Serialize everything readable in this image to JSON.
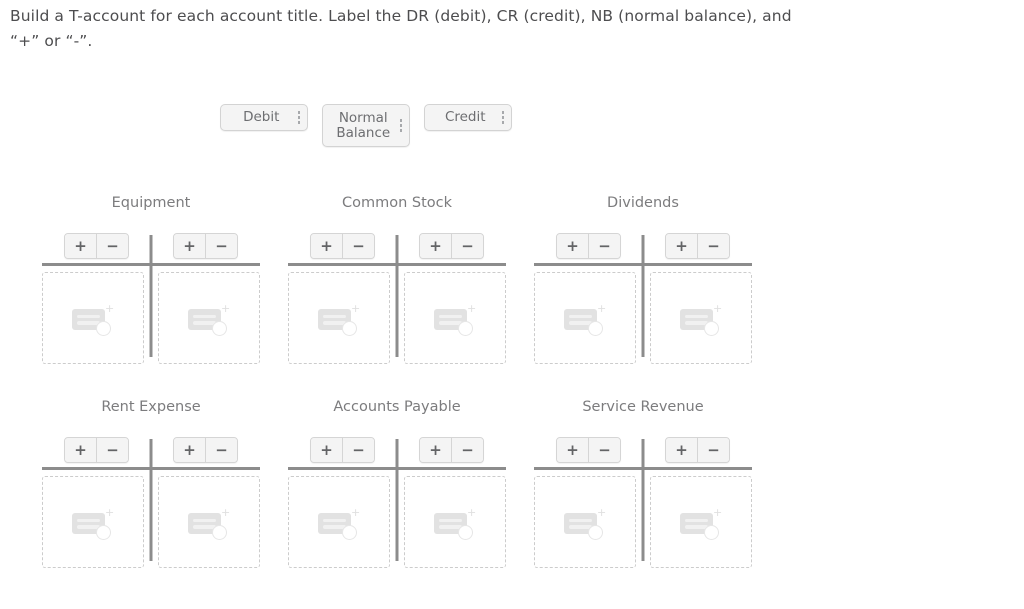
{
  "instructions": {
    "text": "Build a T-account for each account title. Label the DR (debit), CR (credit), NB (normal balance), and “+” or “-”."
  },
  "tokens": [
    {
      "label": "Debit",
      "handle": "drag-handle-icon"
    },
    {
      "label": "Normal\nBalance",
      "handle": "drag-handle-icon"
    },
    {
      "label": "Credit",
      "handle": "drag-handle-icon"
    }
  ],
  "signs": {
    "plus": "+",
    "minus": "−"
  },
  "accounts": [
    {
      "title": "Equipment"
    },
    {
      "title": "Common Stock"
    },
    {
      "title": "Dividends"
    },
    {
      "title": "Rent Expense"
    },
    {
      "title": "Accounts Payable"
    },
    {
      "title": "Service Revenue"
    }
  ],
  "colors": {
    "text": "#4d4d4f",
    "title": "#7c7c7e",
    "rule": "#8c8c8c",
    "dashed_border": "#cccccc",
    "token_bg": "#f4f4f4",
    "token_border": "#d3d3d3"
  }
}
